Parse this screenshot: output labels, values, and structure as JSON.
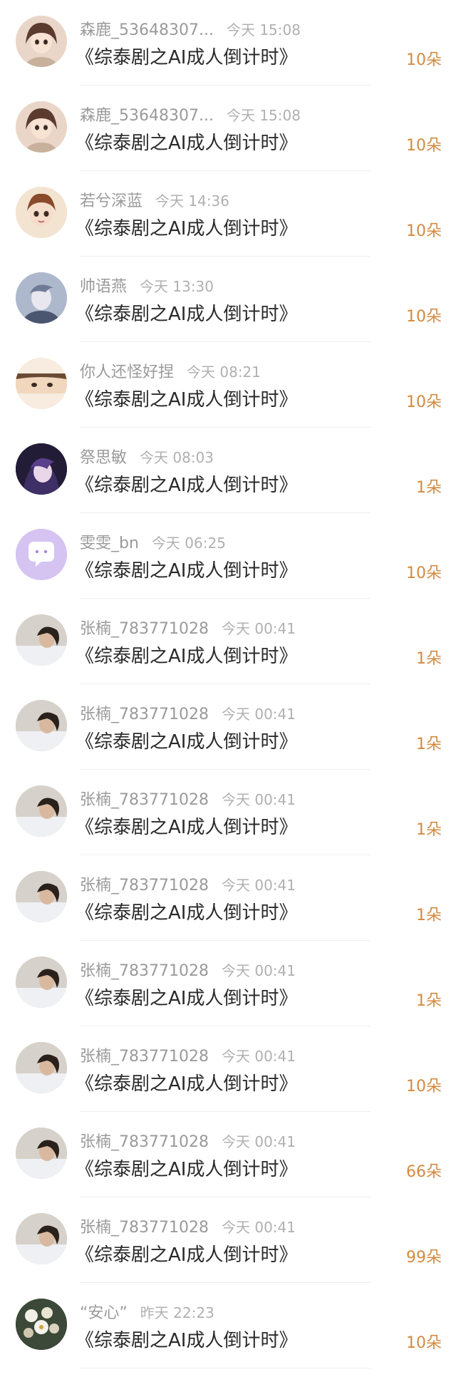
{
  "items": [
    {
      "name": "森鹿_53648307...",
      "time": "今天 15:08",
      "title": "《综泰剧之AI成人倒计时》",
      "count": "10朵",
      "avatar": "girl-doll",
      "color": "#e7cfc1"
    },
    {
      "name": "森鹿_53648307...",
      "time": "今天 15:08",
      "title": "《综泰剧之AI成人倒计时》",
      "count": "10朵",
      "avatar": "girl-doll",
      "color": "#e7cfc1"
    },
    {
      "name": "若兮深蓝",
      "time": "今天 14:36",
      "title": "《综泰剧之AI成人倒计时》",
      "count": "10朵",
      "avatar": "doll-portrait",
      "color": "#f0dcc6"
    },
    {
      "name": "帅语燕",
      "time": "今天 13:30",
      "title": "《综泰剧之AI成人倒计时》",
      "count": "10朵",
      "avatar": "blue-portrait",
      "color": "#b9c3d6"
    },
    {
      "name": "你人还怪好捏",
      "time": "今天 08:21",
      "title": "《综泰剧之AI成人倒计时》",
      "count": "10朵",
      "avatar": "anime-boy",
      "color": "#e8d8c8"
    },
    {
      "name": "祭思敏",
      "time": "今天 08:03",
      "title": "《综泰剧之AI成人倒计时》",
      "count": "1朵",
      "avatar": "dark-anime",
      "color": "#2b2340"
    },
    {
      "name": "雯雯_bn",
      "time": "今天 06:25",
      "title": "《综泰剧之AI成人倒计时》",
      "count": "10朵",
      "avatar": "purple-chat",
      "color": "#d8c8f0"
    },
    {
      "name": "张楠_783771028",
      "time": "今天 00:41",
      "title": "《综泰剧之AI成人倒计时》",
      "count": "1朵",
      "avatar": "photo-woman",
      "color": "#cfc9c2"
    },
    {
      "name": "张楠_783771028",
      "time": "今天 00:41",
      "title": "《综泰剧之AI成人倒计时》",
      "count": "1朵",
      "avatar": "photo-woman",
      "color": "#cfc9c2"
    },
    {
      "name": "张楠_783771028",
      "time": "今天 00:41",
      "title": "《综泰剧之AI成人倒计时》",
      "count": "1朵",
      "avatar": "photo-woman",
      "color": "#cfc9c2"
    },
    {
      "name": "张楠_783771028",
      "time": "今天 00:41",
      "title": "《综泰剧之AI成人倒计时》",
      "count": "1朵",
      "avatar": "photo-woman",
      "color": "#cfc9c2"
    },
    {
      "name": "张楠_783771028",
      "time": "今天 00:41",
      "title": "《综泰剧之AI成人倒计时》",
      "count": "1朵",
      "avatar": "photo-woman",
      "color": "#cfc9c2"
    },
    {
      "name": "张楠_783771028",
      "time": "今天 00:41",
      "title": "《综泰剧之AI成人倒计时》",
      "count": "10朵",
      "avatar": "photo-woman",
      "color": "#cfc9c2"
    },
    {
      "name": "张楠_783771028",
      "time": "今天 00:41",
      "title": "《综泰剧之AI成人倒计时》",
      "count": "66朵",
      "avatar": "photo-woman",
      "color": "#cfc9c2"
    },
    {
      "name": "张楠_783771028",
      "time": "今天 00:41",
      "title": "《综泰剧之AI成人倒计时》",
      "count": "99朵",
      "avatar": "photo-woman",
      "color": "#cfc9c2"
    },
    {
      "name": "“安心”",
      "time": "昨天 22:23",
      "title": "《综泰剧之AI成人倒计时》",
      "count": "10朵",
      "avatar": "flower-bouquet",
      "color": "#3f4a3a"
    }
  ]
}
